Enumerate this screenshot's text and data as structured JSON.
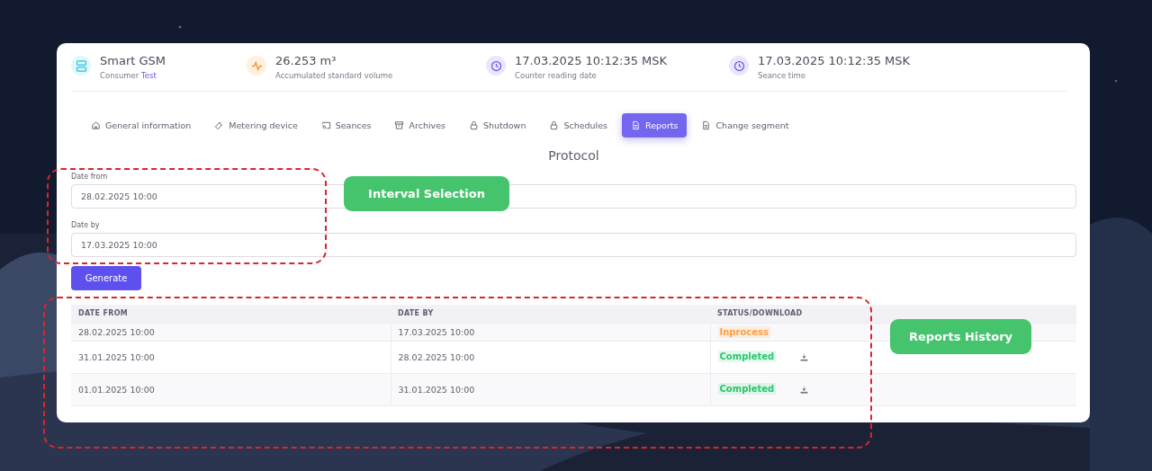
{
  "summary": [
    {
      "title": "Smart GSM",
      "subtitle": "Consumer",
      "subtitle_link": "Test"
    },
    {
      "title": "26.253 m³",
      "subtitle": "Accumulated standard volume"
    },
    {
      "title": "17.03.2025 10:12:35 MSK",
      "subtitle": "Counter reading date"
    },
    {
      "title": "17.03.2025 10:12:35 MSK",
      "subtitle": "Seance time"
    }
  ],
  "tabs": [
    {
      "label": "General information",
      "selected": false
    },
    {
      "label": "Metering device",
      "selected": false
    },
    {
      "label": "Seances",
      "selected": false
    },
    {
      "label": "Archives",
      "selected": false
    },
    {
      "label": "Shutdown",
      "selected": false
    },
    {
      "label": "Schedules",
      "selected": false
    },
    {
      "label": "Reports",
      "selected": true
    },
    {
      "label": "Change segment",
      "selected": false
    }
  ],
  "section_title": "Protocol",
  "fields": [
    {
      "label": "Date from",
      "value": "28.02.2025 10:00"
    },
    {
      "label": "Date by",
      "value": "17.03.2025 10:00"
    }
  ],
  "generate_button": "Generate",
  "table": {
    "columns": [
      "DATE FROM",
      "DATE BY",
      "STATUS/DOWNLOAD"
    ],
    "rows": [
      {
        "date_from": "28.02.2025 10:00",
        "date_by": "17.03.2025 10:00",
        "status": "Inprocess",
        "color": "#ff9f43",
        "downloadable": false
      },
      {
        "date_from": "31.01.2025 10:00",
        "date_by": "28.02.2025 10:00",
        "status": "Completed",
        "color": "#28c76f",
        "downloadable": true
      },
      {
        "date_from": "01.01.2025 10:00",
        "date_by": "31.01.2025 10:00",
        "status": "Completed",
        "color": "#28c76f",
        "downloadable": true
      }
    ]
  },
  "annotations": [
    "Interval Selection",
    "Reports History"
  ]
}
